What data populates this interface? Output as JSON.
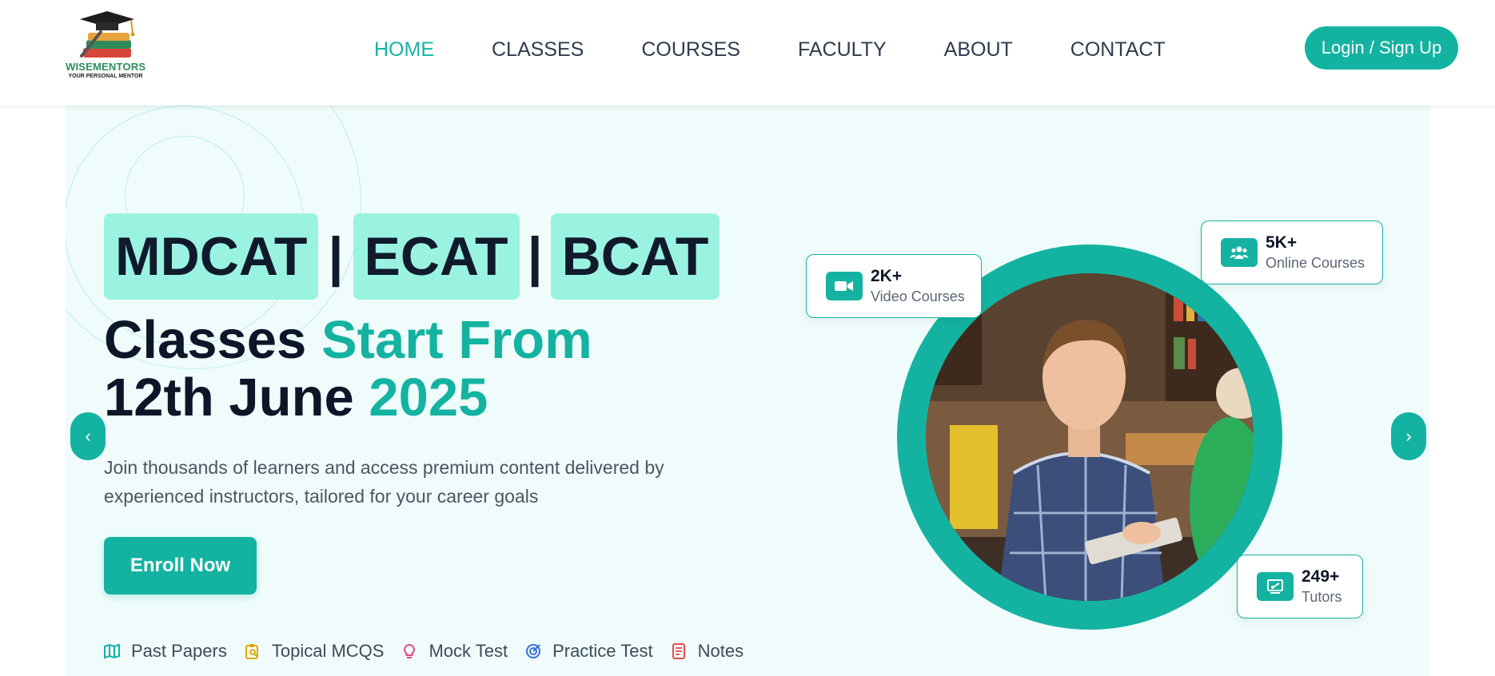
{
  "brand": {
    "name": "WISEMENTORS",
    "tagline": "YOUR PERSONAL MENTOR"
  },
  "nav": {
    "items": [
      "HOME",
      "CLASSES",
      "COURSES",
      "FACULTY",
      "ABOUT",
      "CONTACT"
    ],
    "active": "HOME"
  },
  "header": {
    "login_label": "Login / Sign Up"
  },
  "hero": {
    "exams": [
      "MDCAT",
      "ECAT",
      "BCAT"
    ],
    "separator": "|",
    "headline_part1": "Classes ",
    "headline_accent1": "Start From",
    "headline_part2": "12th June ",
    "headline_accent2": "2025",
    "description": "Join thousands of learners and access premium content delivered by experienced instructors, tailored for your career goals",
    "enroll_label": "Enroll Now",
    "prev_label": "‹",
    "next_label": "›"
  },
  "features": [
    {
      "label": "Past Papers",
      "icon": "map-icon"
    },
    {
      "label": "Topical MCQS",
      "icon": "clipboard-search-icon"
    },
    {
      "label": "Mock Test",
      "icon": "lightbulb-icon"
    },
    {
      "label": "Practice Test",
      "icon": "target-icon"
    },
    {
      "label": "Notes",
      "icon": "notes-icon"
    }
  ],
  "stats": {
    "video": {
      "value": "2K+",
      "label": "Video Courses",
      "icon": "video-camera-icon"
    },
    "online": {
      "value": "5K+",
      "label": "Online Courses",
      "icon": "users-icon"
    },
    "tutors": {
      "value": "249+",
      "label": "Tutors",
      "icon": "presentation-icon"
    }
  },
  "colors": {
    "accent": "#14b3a1",
    "chip": "#9af3e1",
    "hero_bg": "#effcfb",
    "dark_text": "#0d1628"
  }
}
